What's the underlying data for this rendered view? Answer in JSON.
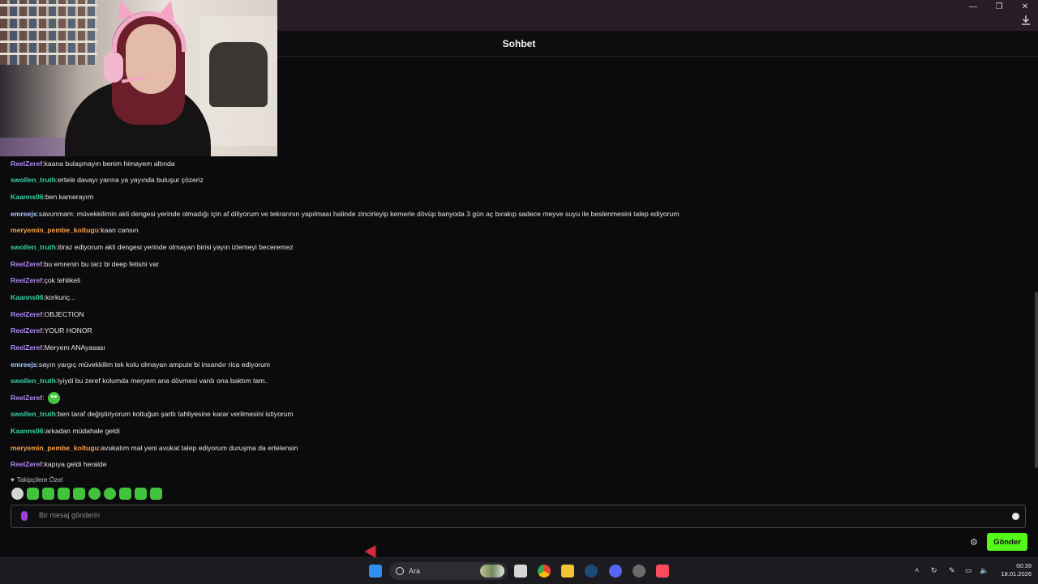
{
  "header": {
    "title": "Sohbet"
  },
  "window_controls": [
    "—",
    "❐",
    "✕"
  ],
  "messages": [
    {
      "user": "ReelZeref",
      "color": "#b389f5",
      "text": "kaana bulaşmayın benim himayem altında"
    },
    {
      "user": "swollen_truth",
      "color": "#38d4a4",
      "text": "ertele davayı yarına ya yayında buluşur çözeriz"
    },
    {
      "user": "Kaanns06",
      "color": "#38d4a4",
      "text": "ben kamerayım"
    },
    {
      "user": "emreejs",
      "color": "#a9c9ff",
      "text": "savunmam: müvekkilimin akli dengesi yerinde olmadığı için af diliyorum ve tekrarının yapılması halinde zincirleyip kemerle dövüp banyoda 3 gün aç bırakıp sadece meyve suyu ile beslenmesini talep ediyorum"
    },
    {
      "user": "meryemin_pembe_koltugu",
      "color": "#f7a04b",
      "text": "kaan cansın"
    },
    {
      "user": "swollen_truth",
      "color": "#38d4a4",
      "text": "itiraz ediyorum akli dengesi yerinde olmayan birisi yayın izlemeyi beceremez"
    },
    {
      "user": "ReelZeref",
      "color": "#b389f5",
      "text": "bu emrenin bu tarz bi deep fetishi var"
    },
    {
      "user": "ReelZeref",
      "color": "#b389f5",
      "text": "çok tehlikeli"
    },
    {
      "user": "Kaanns06",
      "color": "#38d4a4",
      "text": "korkunç..."
    },
    {
      "user": "ReelZeref",
      "color": "#b389f5",
      "text": "OBJECTION"
    },
    {
      "user": "ReelZeref",
      "color": "#b389f5",
      "text": "YOUR HONOR"
    },
    {
      "user": "ReelZeref",
      "color": "#b389f5",
      "text": "Meryem ANAyasası"
    },
    {
      "user": "emreejs",
      "color": "#a9c9ff",
      "text": "sayın yargıç müvekkilim tek kolu olmayan ampute bi insandır rica ediyorum"
    },
    {
      "user": "swollen_truth",
      "color": "#38d4a4",
      "text": "iyiydi bu zeref kolumda meryem ana dövmesi vardı ona baktım tam.."
    },
    {
      "user": "ReelZeref",
      "color": "#b389f5",
      "text": "",
      "emote": "green-blob-emote"
    },
    {
      "user": "swollen_truth",
      "color": "#38d4a4",
      "text": "ben taraf değiştiriyorum koltuğun şartlı tahliyesine karar verilmesini istiyorum"
    },
    {
      "user": "Kaanns06",
      "color": "#38d4a4",
      "text": "arkadan müdahale geldi"
    },
    {
      "user": "meryemin_pembe_koltugu",
      "color": "#f7a04b",
      "text": "avukatım mal yeni avukat talep ediyorum duruşma da ertelensin"
    },
    {
      "user": "ReelZeref",
      "color": "#b389f5",
      "text": "kapıya geldi heralde"
    }
  ],
  "followers_only": {
    "label": "Takipçilere Özel"
  },
  "emote_picker": [
    "emote-1",
    "emote-2",
    "emote-3",
    "emote-4",
    "emote-5",
    "emote-6",
    "emote-7",
    "emote-8",
    "emote-9",
    "emote-10"
  ],
  "composer": {
    "placeholder": "Bir mesaj gönderin",
    "send_label": "Gönder",
    "accent": "#53fc18"
  },
  "taskbar": {
    "search_label": "Ara",
    "time": "00:39",
    "date": "18.01.2026"
  }
}
